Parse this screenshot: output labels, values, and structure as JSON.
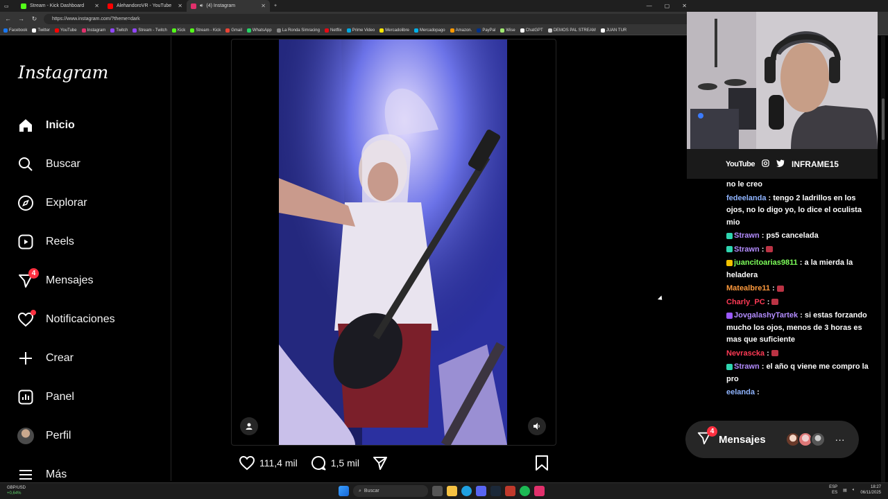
{
  "browser": {
    "tabs": [
      {
        "label": "Stream - Kick Dashboard",
        "color": "#53fc18"
      },
      {
        "label": "AlehandoroVR - YouTube",
        "color": "#ff0000"
      },
      {
        "label": "(4) Instagram",
        "color": "#e1306c",
        "active": true
      }
    ],
    "url": "https://www.instagram.com/?theme=dark",
    "bookmarks": [
      {
        "label": "Facebook",
        "color": "#1877f2"
      },
      {
        "label": "Twitter",
        "color": "#ffffff"
      },
      {
        "label": "YouTube",
        "color": "#ff0000"
      },
      {
        "label": "Instagram",
        "color": "#e1306c"
      },
      {
        "label": "Twitch",
        "color": "#9146ff"
      },
      {
        "label": "Stream - Twitch",
        "color": "#9146ff"
      },
      {
        "label": "Kick",
        "color": "#53fc18"
      },
      {
        "label": "Stream - Kick",
        "color": "#53fc18"
      },
      {
        "label": "Gmail",
        "color": "#ea4335"
      },
      {
        "label": "WhatsApp",
        "color": "#25d366"
      },
      {
        "label": "La Ronda Simracing",
        "color": "#888888"
      },
      {
        "label": "Netflix",
        "color": "#e50914"
      },
      {
        "label": "Prime Video",
        "color": "#00a8e1"
      },
      {
        "label": "Mercadolibre",
        "color": "#ffe600"
      },
      {
        "label": "Mercadopago",
        "color": "#00b1ea"
      },
      {
        "label": "Amazon.",
        "color": "#ff9900"
      },
      {
        "label": "PayPal",
        "color": "#003087"
      },
      {
        "label": "Wise",
        "color": "#9fe870"
      },
      {
        "label": "ChatGPT",
        "color": "#ffffff"
      },
      {
        "label": "DEMOS PAL STREAM",
        "color": "#cccccc"
      },
      {
        "label": "JUAN TUR",
        "color": "#ffffff"
      }
    ]
  },
  "instagram": {
    "logo": "Instagram",
    "nav": [
      {
        "label": "Inicio",
        "icon": "home-icon",
        "bold": true
      },
      {
        "label": "Buscar",
        "icon": "search-icon"
      },
      {
        "label": "Explorar",
        "icon": "compass-icon"
      },
      {
        "label": "Reels",
        "icon": "reels-icon"
      },
      {
        "label": "Mensajes",
        "icon": "messenger-icon",
        "badge": "4"
      },
      {
        "label": "Notificaciones",
        "icon": "heart-icon",
        "dot": true
      },
      {
        "label": "Crear",
        "icon": "plus-icon"
      },
      {
        "label": "Panel",
        "icon": "chart-icon"
      },
      {
        "label": "Perfil",
        "icon": "avatar-icon"
      },
      {
        "label": "Más",
        "icon": "menu-icon"
      }
    ],
    "post": {
      "likes": "111,4 mil",
      "comments": "1,5 mil"
    },
    "messages_pill": {
      "label": "Mensajes",
      "badge": "4"
    }
  },
  "stream": {
    "socials": {
      "youtube": "YouTube",
      "handle": "INFRAME15"
    },
    "chat": [
      {
        "user": "",
        "text": "no le creo",
        "color": "#ffffff"
      },
      {
        "user": "fedeelanda",
        "text": "tengo 2 ladrillos en los ojos, no lo digo yo, lo dice el oculista mio",
        "color": "#8fb4ff"
      },
      {
        "user": "Strawn",
        "text": "ps5 cancelada",
        "color": "#b38cff",
        "badge": "#2fd5b0"
      },
      {
        "user": "Strawn",
        "text": "",
        "color": "#b38cff",
        "badge": "#2fd5b0",
        "emote": true
      },
      {
        "user": "juancitoarias9811",
        "text": "a la mierda la heladera",
        "color": "#7dff5a",
        "badge": "#f2c200"
      },
      {
        "user": "Matealbre11",
        "text": "",
        "color": "#ff9a3d",
        "emote": true
      },
      {
        "user": "Charly_PC",
        "text": "",
        "color": "#ff3a55",
        "emote": true
      },
      {
        "user": "JovgalashyTartek",
        "text": "si estas forzando mucho los ojos, menos de 3 horas es mas que suficiente",
        "color": "#b38cff",
        "badge": "#9b59ff"
      },
      {
        "user": "Nevrascka",
        "text": "",
        "color": "#ff3a55",
        "emote": true
      },
      {
        "user": "Strawn",
        "text": "el año q viene me compro la pro",
        "color": "#b38cff",
        "badge": "#2fd5b0"
      },
      {
        "user": "eelanda",
        "text": "",
        "color": "#8fb4ff"
      }
    ]
  },
  "taskbar": {
    "ticker": "GBP/USD",
    "change": "+0,64%",
    "search": "Buscar",
    "lang1": "ESP",
    "lang2": "ES",
    "time": "18:27",
    "date": "06/11/2025"
  }
}
